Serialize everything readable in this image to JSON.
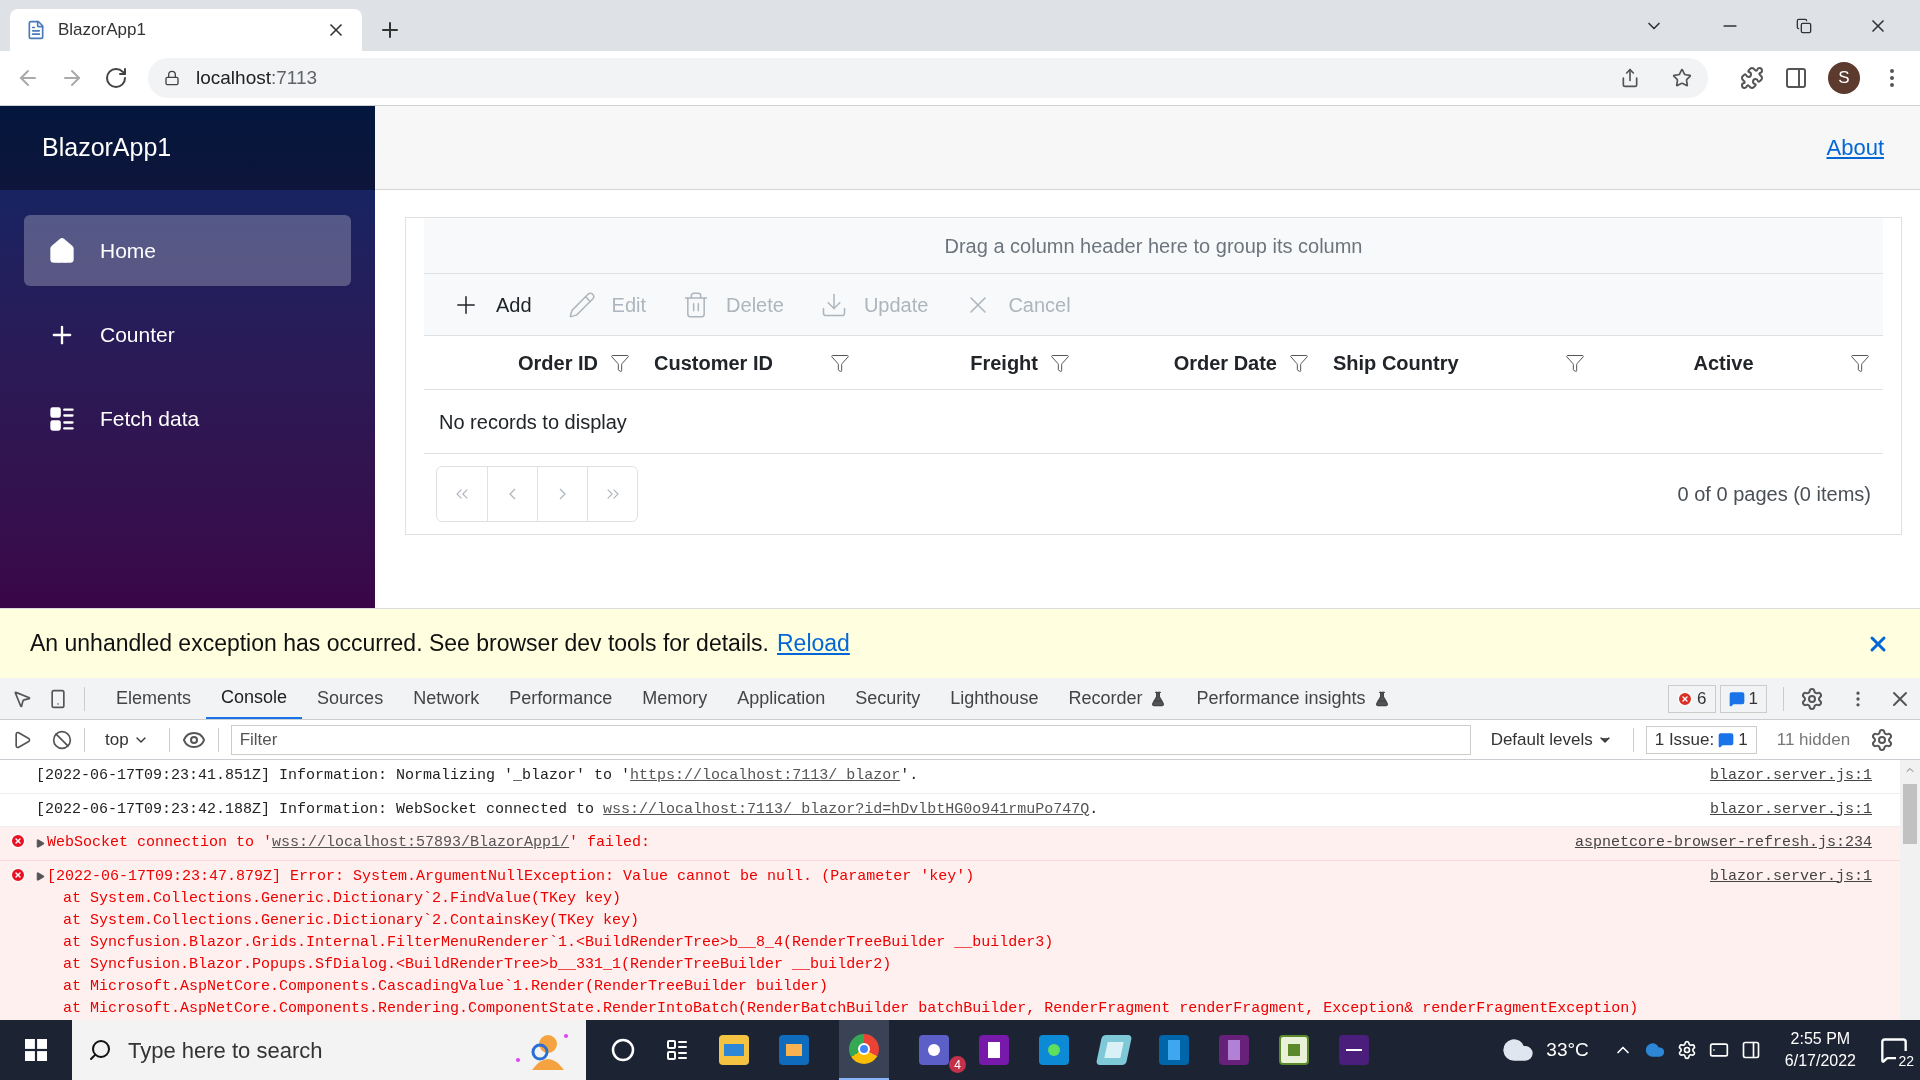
{
  "browser": {
    "tab": {
      "title": "BlazorApp1"
    },
    "address": {
      "host": "localhost",
      "port": ":7113"
    },
    "avatar": "S"
  },
  "app": {
    "brand": "BlazorApp1",
    "nav": [
      {
        "label": "Home",
        "selected": true
      },
      {
        "label": "Counter",
        "selected": false
      },
      {
        "label": "Fetch data",
        "selected": false
      }
    ],
    "about_link": "About",
    "grid": {
      "group_hint": "Drag a column header here to group its column",
      "toolbar": [
        {
          "label": "Add",
          "disabled": false
        },
        {
          "label": "Edit",
          "disabled": true
        },
        {
          "label": "Delete",
          "disabled": true
        },
        {
          "label": "Update",
          "disabled": true
        },
        {
          "label": "Cancel",
          "disabled": true
        }
      ],
      "columns": [
        "Order ID",
        "Customer ID",
        "Freight",
        "Order Date",
        "Ship Country",
        "Active"
      ],
      "empty_message": "No records to display",
      "pager": {
        "info": "0 of 0 pages (0 items)"
      }
    }
  },
  "error_banner": {
    "message": "An unhandled exception has occurred. See browser dev tools for details.",
    "link": "Reload"
  },
  "devtools": {
    "tabs": [
      {
        "label": "Elements",
        "selected": false,
        "experimental": false
      },
      {
        "label": "Console",
        "selected": true,
        "experimental": false
      },
      {
        "label": "Sources",
        "selected": false,
        "experimental": false
      },
      {
        "label": "Network",
        "selected": false,
        "experimental": false
      },
      {
        "label": "Performance",
        "selected": false,
        "experimental": false
      },
      {
        "label": "Memory",
        "selected": false,
        "experimental": false
      },
      {
        "label": "Application",
        "selected": false,
        "experimental": false
      },
      {
        "label": "Security",
        "selected": false,
        "experimental": false
      },
      {
        "label": "Lighthouse",
        "selected": false,
        "experimental": false
      },
      {
        "label": "Recorder",
        "selected": false,
        "experimental": true
      },
      {
        "label": "Performance insights",
        "selected": false,
        "experimental": true
      }
    ],
    "error_count": "6",
    "message_count": "1",
    "context": "top",
    "filter_placeholder": "Filter",
    "levels": "Default levels",
    "issues_label": "1 Issue:",
    "issues_count": "1",
    "hidden": "11 hidden",
    "messages": [
      {
        "kind": "info",
        "expandable": false,
        "parts": [
          {
            "text": "[2022-06-17T09:23:41.851Z] Information: Normalizing '_blazor' to '",
            "link": false
          },
          {
            "text": "https://localhost:7113/_blazor",
            "link": true
          },
          {
            "text": "'.",
            "link": false
          }
        ],
        "source": "blazor.server.js:1"
      },
      {
        "kind": "info",
        "expandable": false,
        "parts": [
          {
            "text": "[2022-06-17T09:23:42.188Z] Information: WebSocket connected to ",
            "link": false
          },
          {
            "text": "wss://localhost:7113/_blazor?id=hDvlbtHG0o941rmuPo747Q",
            "link": true
          },
          {
            "text": ".",
            "link": false
          }
        ],
        "source": "blazor.server.js:1"
      },
      {
        "kind": "error",
        "expandable": true,
        "parts": [
          {
            "text": "WebSocket connection to '",
            "link": false
          },
          {
            "text": "wss://localhost:57893/BlazorApp1/",
            "link": true
          },
          {
            "text": "' failed:",
            "link": false
          }
        ],
        "source": "aspnetcore-browser-refresh.js:234"
      },
      {
        "kind": "error",
        "expandable": true,
        "parts": [
          {
            "text": "[2022-06-17T09:23:47.879Z] Error: System.ArgumentNullException: Value cannot be null. (Parameter 'key')",
            "link": false
          }
        ],
        "source": "blazor.server.js:1",
        "stack": [
          "at System.Collections.Generic.Dictionary`2.FindValue(TKey key)",
          "at System.Collections.Generic.Dictionary`2.ContainsKey(TKey key)",
          "at Syncfusion.Blazor.Grids.Internal.FilterMenuRenderer`1.<BuildRenderTree>b__8_4(RenderTreeBuilder __builder3)",
          "at Syncfusion.Blazor.Popups.SfDialog.<BuildRenderTree>b__331_1(RenderTreeBuilder __builder2)",
          "at Microsoft.AspNetCore.Components.CascadingValue`1.Render(RenderTreeBuilder builder)",
          "at Microsoft.AspNetCore.Components.Rendering.ComponentState.RenderIntoBatch(RenderBatchBuilder batchBuilder, RenderFragment renderFragment, Exception& renderFragmentException)"
        ]
      }
    ]
  },
  "taskbar": {
    "search_placeholder": "Type here to search",
    "teams_badge": "4",
    "temperature": "33°C",
    "time": "2:55 PM",
    "date": "6/17/2022",
    "notifications": "22"
  }
}
